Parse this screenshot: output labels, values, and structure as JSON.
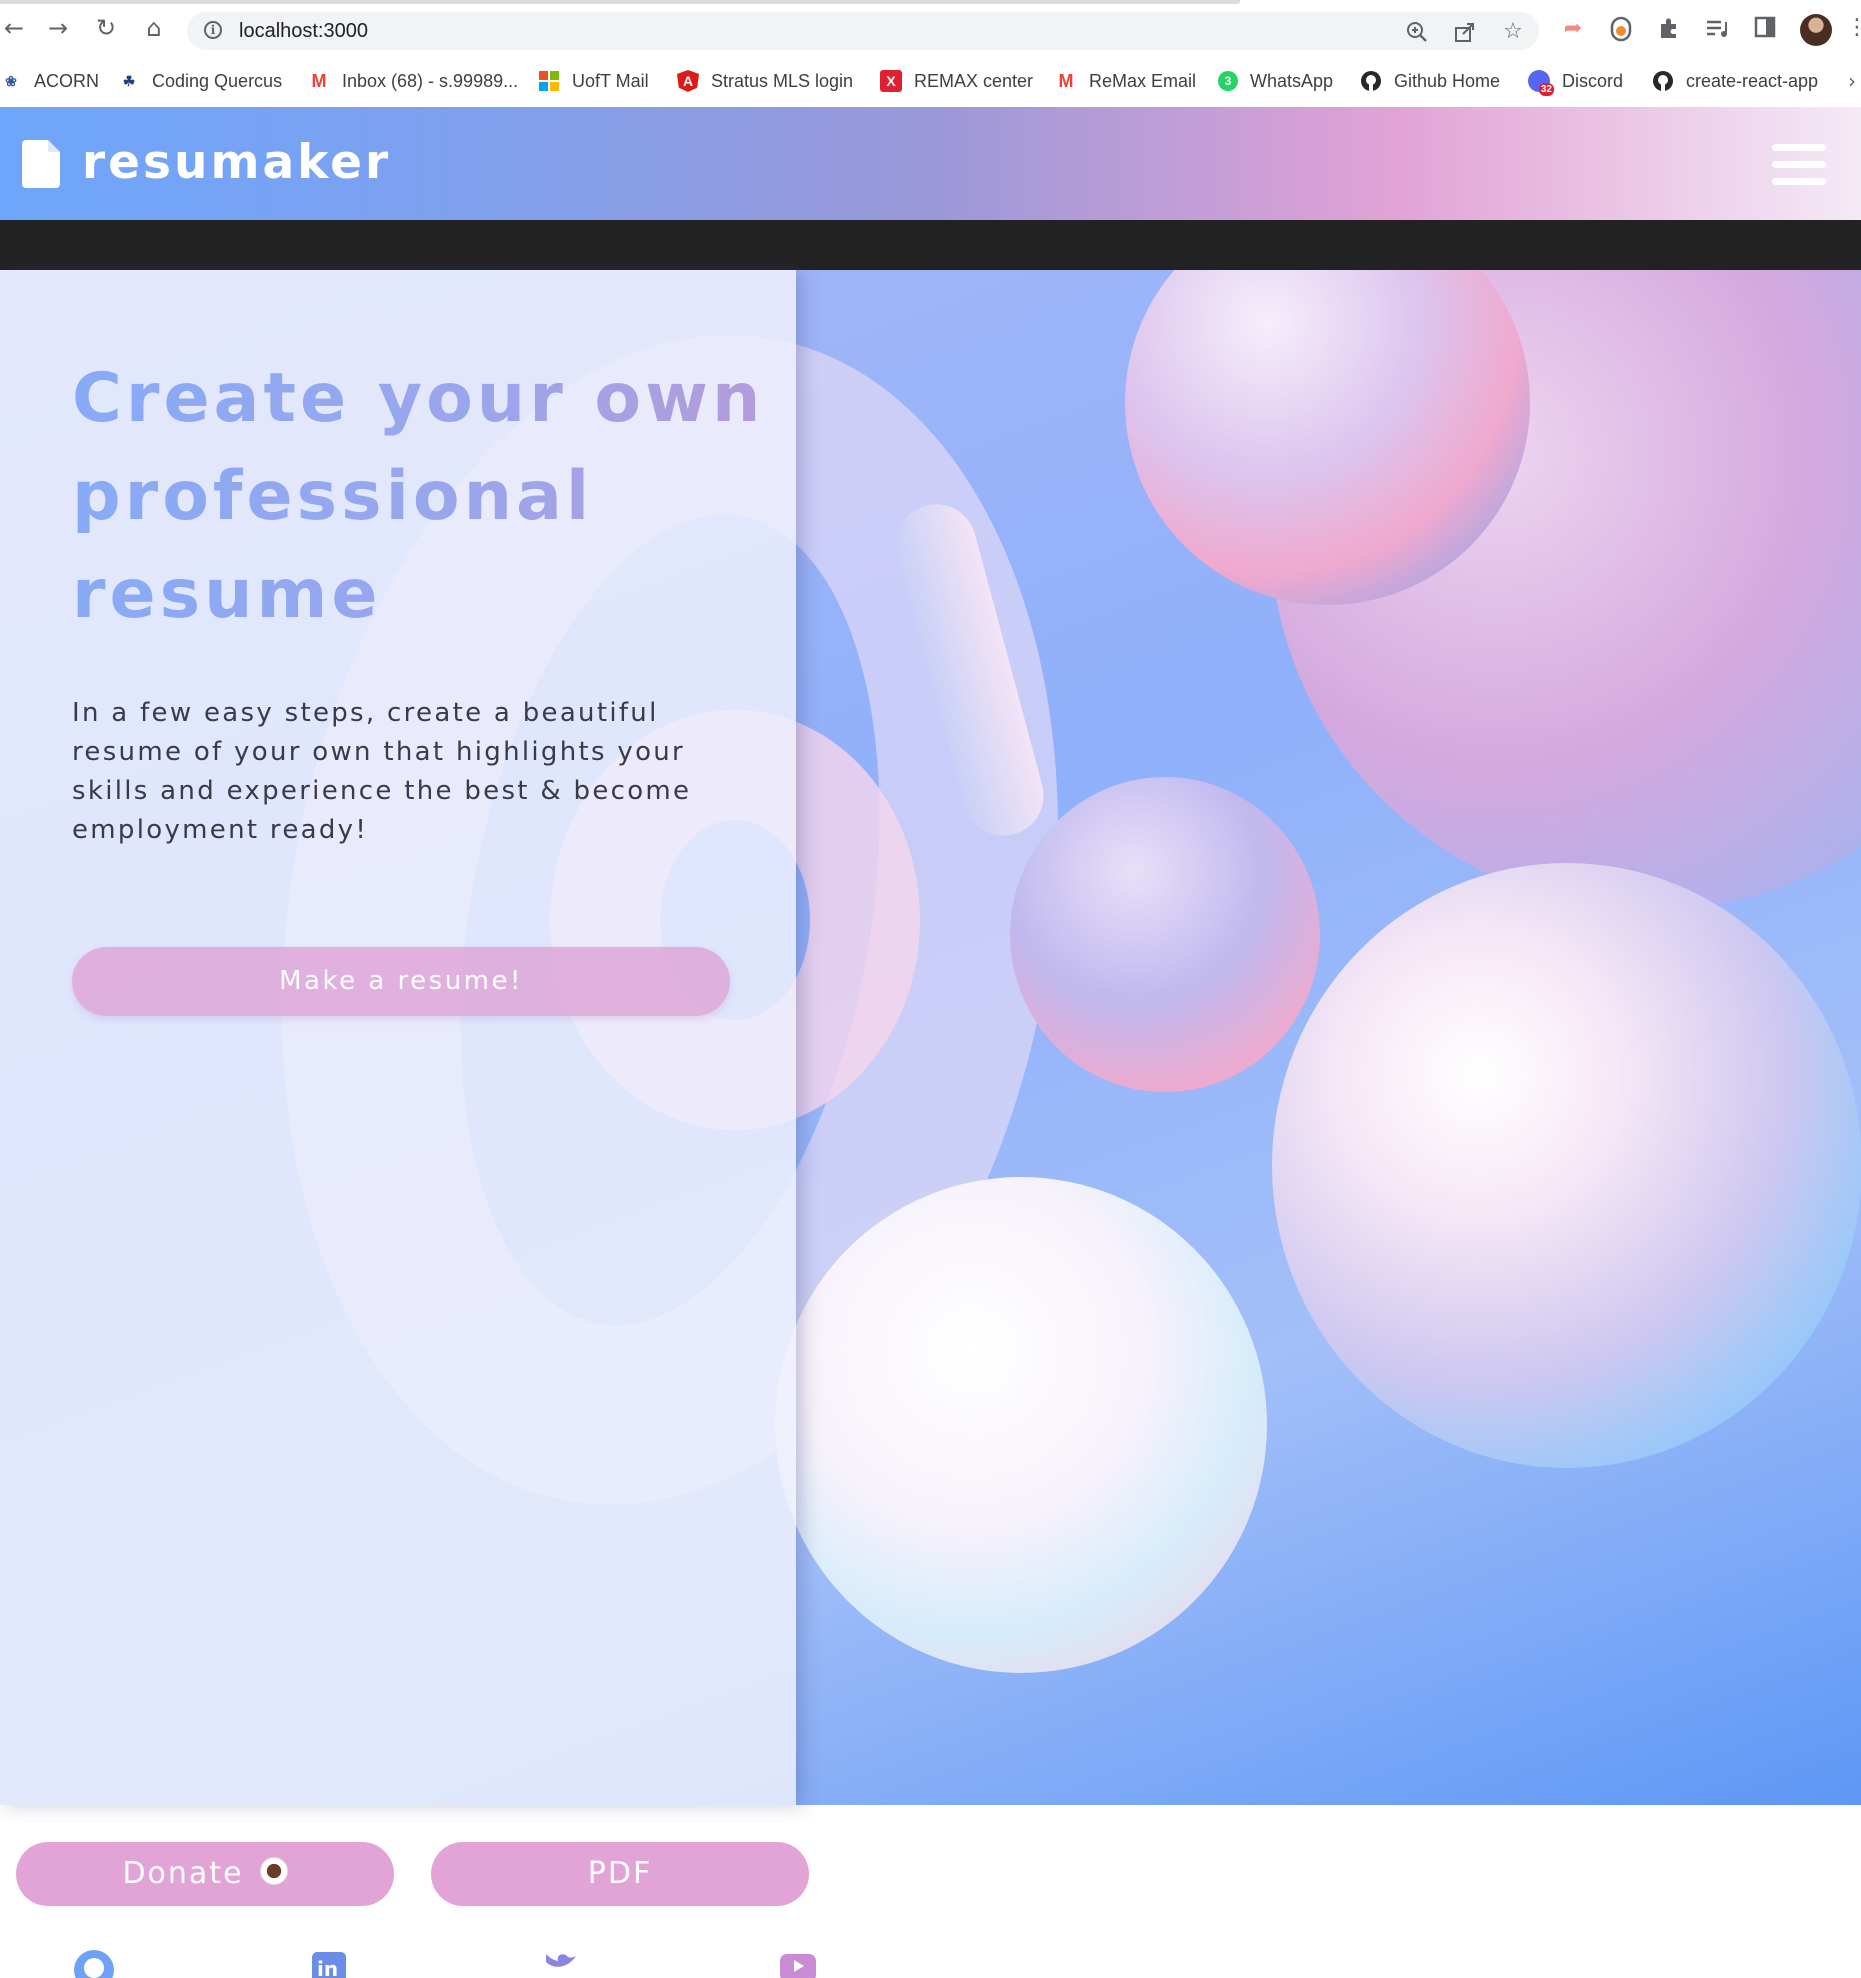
{
  "browser": {
    "url": "localhost:3000",
    "nav": {
      "back_icon": "back-arrow-icon",
      "forward_icon": "forward-arrow-icon",
      "reload_icon": "reload-icon",
      "home_icon": "home-icon"
    },
    "bookmarks": [
      {
        "label": "ACORN",
        "icon": "acorn-icon",
        "color": "#2f5a9e"
      },
      {
        "label": "Coding Quercus",
        "icon": "quercus-icon",
        "color": "#1f3f7a"
      },
      {
        "label": "Inbox (68) - s.99989...",
        "icon": "gmail-icon",
        "color": "#ea4335"
      },
      {
        "label": "UofT Mail",
        "icon": "microsoft-icon",
        "color": "#f25022"
      },
      {
        "label": "Stratus MLS login",
        "icon": "angular-icon",
        "color": "#dd1b16"
      },
      {
        "label": "REMAX center",
        "icon": "remax-icon",
        "color": "#e02030"
      },
      {
        "label": "ReMax Email",
        "icon": "gmail-icon",
        "color": "#ea4335"
      },
      {
        "label": "WhatsApp",
        "icon": "whatsapp-icon",
        "color": "#25d366"
      },
      {
        "label": "Github Home",
        "icon": "github-icon",
        "color": "#24292e"
      },
      {
        "label": "Discord",
        "icon": "discord-icon",
        "color": "#5865f2"
      },
      {
        "label": "create-react-app",
        "icon": "github-icon",
        "color": "#24292e"
      }
    ],
    "badges": {
      "whatsapp": "3",
      "discord": "32"
    }
  },
  "header": {
    "brand": "resumaker",
    "menu_icon": "hamburger-menu-icon"
  },
  "hero": {
    "title": "Create your own professional resume",
    "description": "In a few easy steps, create a beautiful resume of your own that highlights your skills and experience the best & become employment ready!",
    "cta_label": "Make a resume!"
  },
  "footer": {
    "donate_label": "Donate",
    "pdf_label": "PDF",
    "social_icons": [
      "github-icon",
      "linkedin-icon",
      "twitter-icon",
      "youtube-icon"
    ]
  },
  "colors": {
    "accent_pink": "#e2a4d6",
    "accent_blue": "#6ea6fb",
    "dark_band": "#222222"
  }
}
